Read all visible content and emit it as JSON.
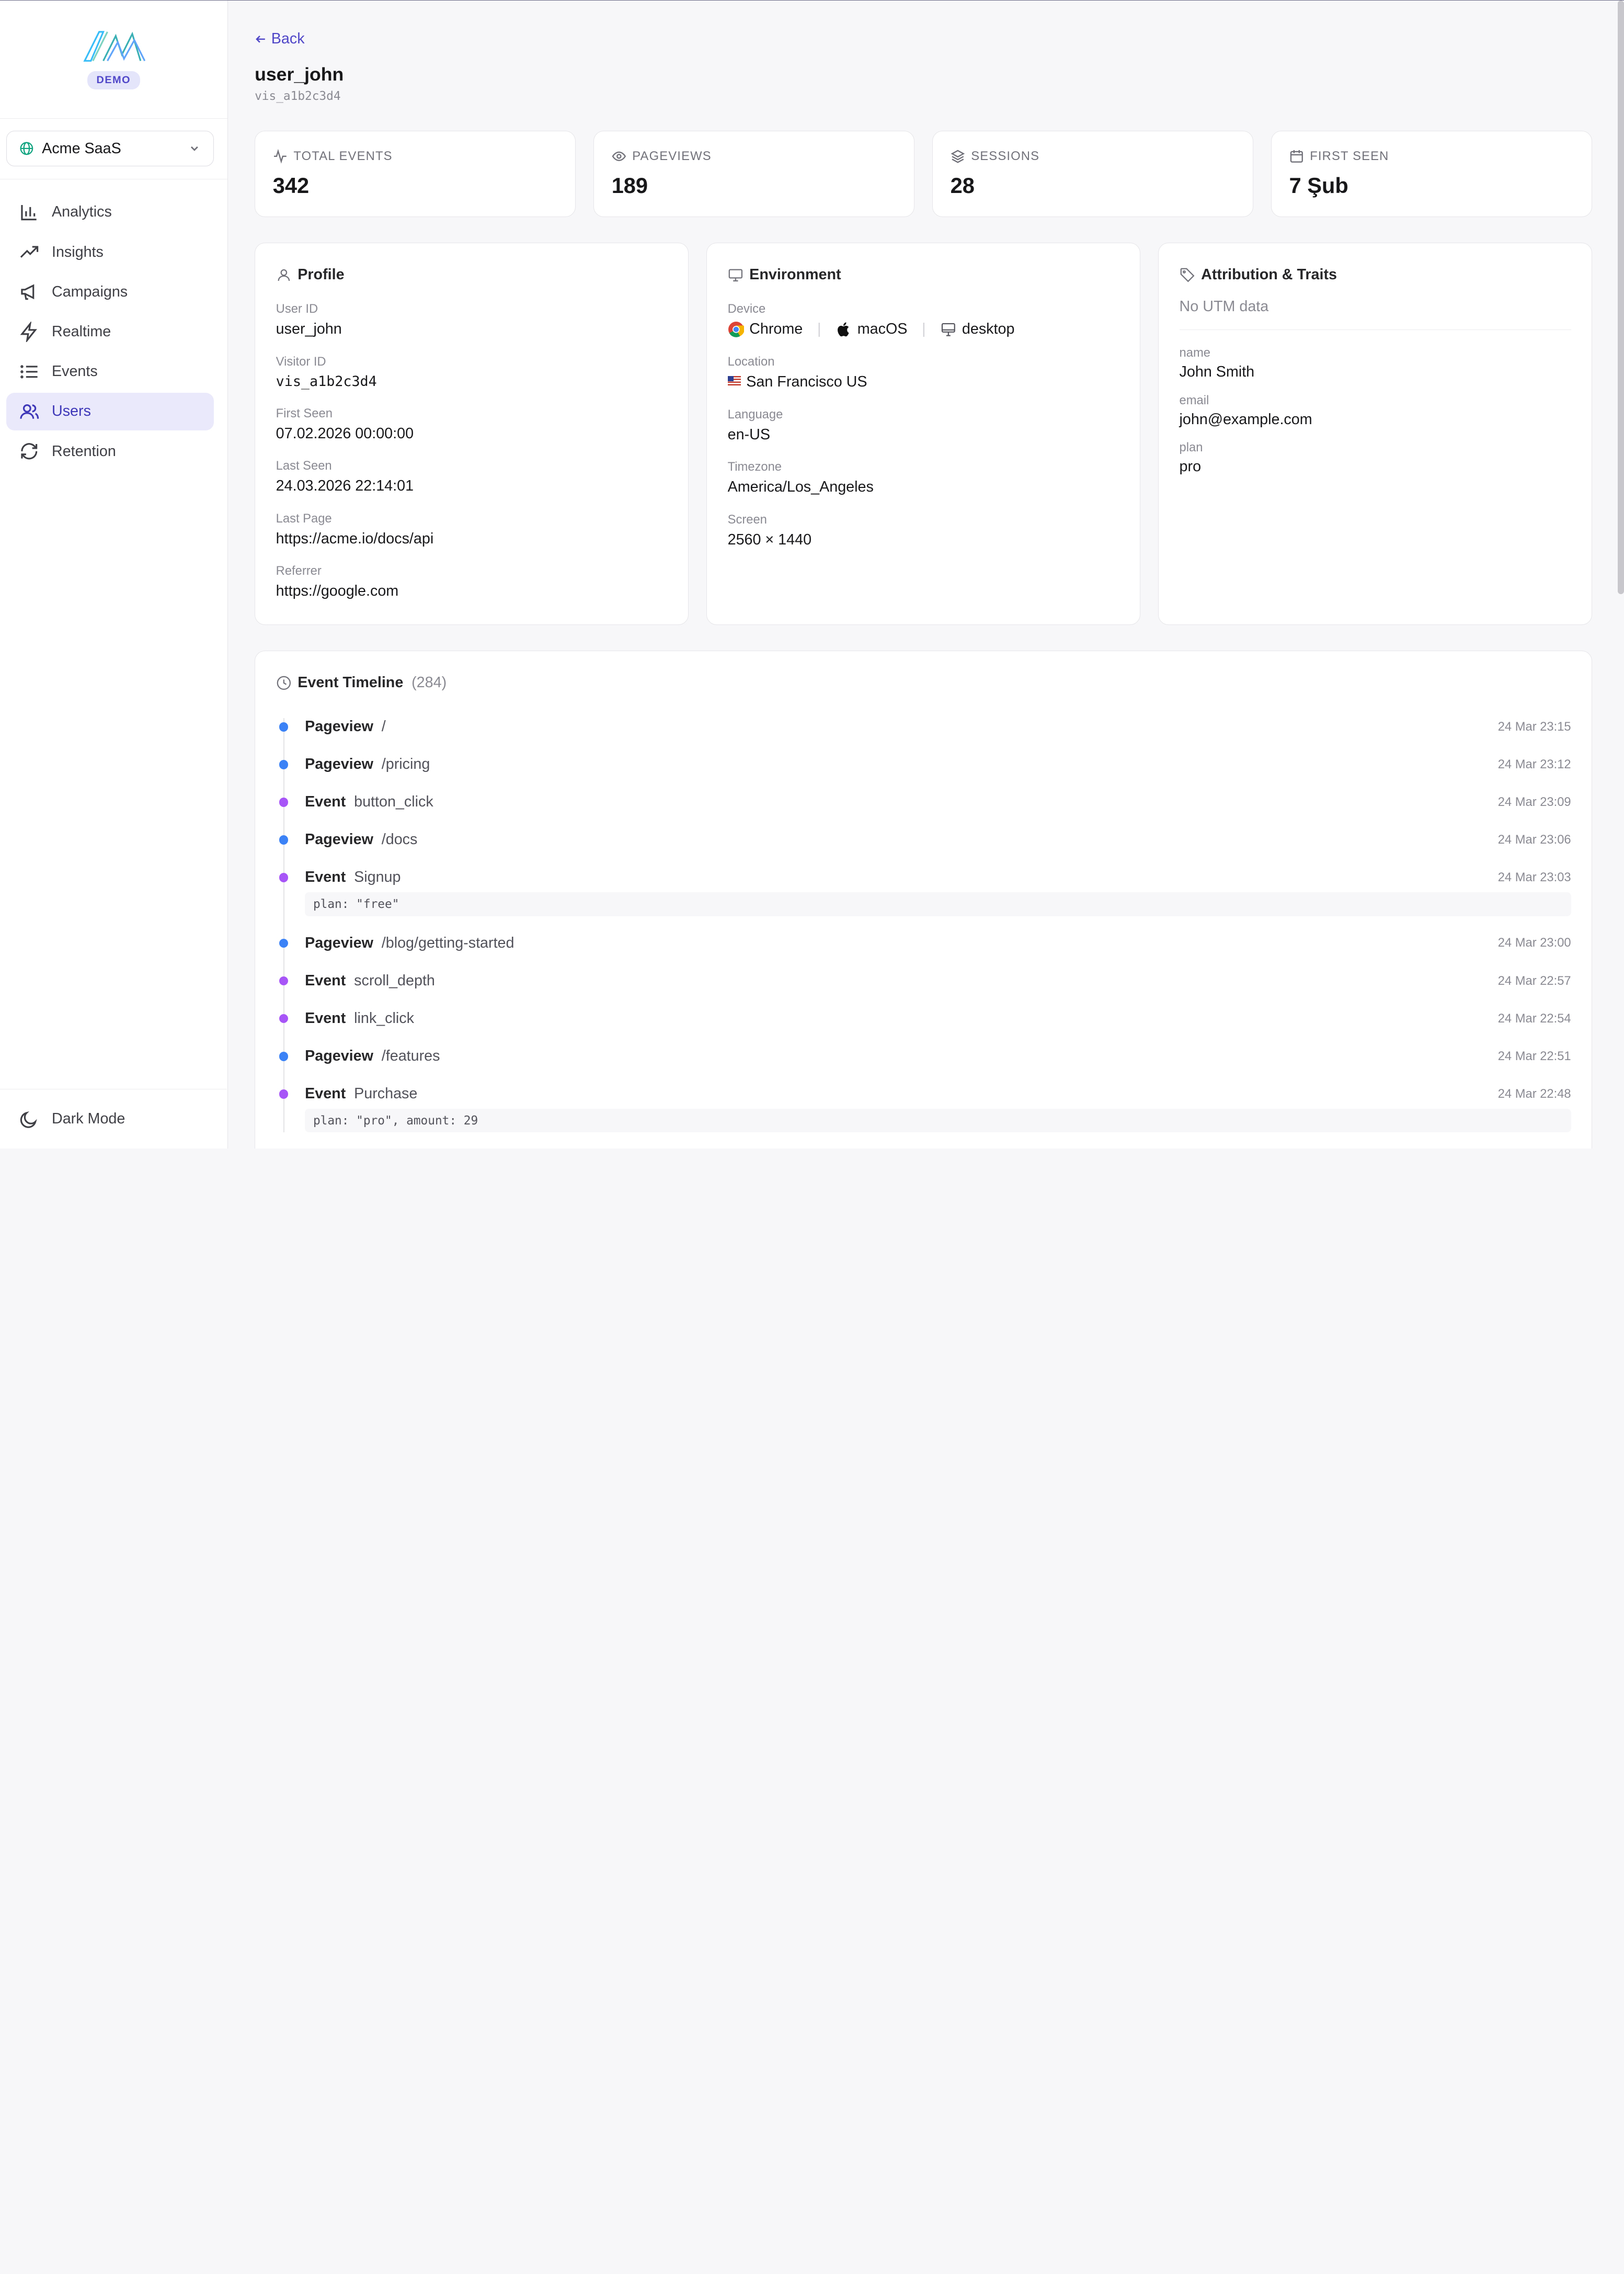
{
  "brand": {
    "badge": "DEMO"
  },
  "site_selector": {
    "value": "Acme SaaS"
  },
  "nav": {
    "items": [
      {
        "label": "Analytics",
        "icon": "bar-chart-icon"
      },
      {
        "label": "Insights",
        "icon": "trending-up-icon"
      },
      {
        "label": "Campaigns",
        "icon": "megaphone-icon"
      },
      {
        "label": "Realtime",
        "icon": "zap-icon"
      },
      {
        "label": "Events",
        "icon": "list-icon"
      },
      {
        "label": "Users",
        "icon": "users-icon",
        "active": true
      },
      {
        "label": "Retention",
        "icon": "refresh-icon"
      }
    ],
    "dark_mode": "Dark Mode"
  },
  "header": {
    "back": "Back",
    "title": "user_john",
    "subtitle": "vis_a1b2c3d4"
  },
  "stats": [
    {
      "label": "TOTAL EVENTS",
      "value": "342",
      "icon": "activity-icon"
    },
    {
      "label": "PAGEVIEWS",
      "value": "189",
      "icon": "eye-icon"
    },
    {
      "label": "SESSIONS",
      "value": "28",
      "icon": "layers-icon"
    },
    {
      "label": "FIRST SEEN",
      "value": "7 Şub",
      "icon": "calendar-icon"
    }
  ],
  "profile": {
    "title": "Profile",
    "fields": [
      {
        "label": "User ID",
        "value": "user_john"
      },
      {
        "label": "Visitor ID",
        "value": "vis_a1b2c3d4"
      },
      {
        "label": "First Seen",
        "value": "07.02.2026 00:00:00"
      },
      {
        "label": "Last Seen",
        "value": "24.03.2026 22:14:01"
      },
      {
        "label": "Last Page",
        "value": "https://acme.io/docs/api"
      },
      {
        "label": "Referrer",
        "value": "https://google.com"
      }
    ]
  },
  "environment": {
    "title": "Environment",
    "device_label": "Device",
    "browser": "Chrome",
    "os": "macOS",
    "device_type": "desktop",
    "location_label": "Location",
    "location": "San Francisco US",
    "language_label": "Language",
    "language": "en-US",
    "timezone_label": "Timezone",
    "timezone": "America/Los_Angeles",
    "screen_label": "Screen",
    "screen": "2560 × 1440"
  },
  "attribution": {
    "title": "Attribution & Traits",
    "no_utm": "No UTM data",
    "traits": [
      {
        "label": "name",
        "value": "John Smith"
      },
      {
        "label": "email",
        "value": "john@example.com"
      },
      {
        "label": "plan",
        "value": "pro"
      }
    ]
  },
  "timeline": {
    "title": "Event Timeline",
    "count": "(284)",
    "items": [
      {
        "kind": "pv",
        "type": "Pageview",
        "name": "/",
        "time": "24 Mar 23:15"
      },
      {
        "kind": "pv",
        "type": "Pageview",
        "name": "/pricing",
        "time": "24 Mar 23:12"
      },
      {
        "kind": "ev",
        "type": "Event",
        "name": "button_click",
        "time": "24 Mar 23:09"
      },
      {
        "kind": "pv",
        "type": "Pageview",
        "name": "/docs",
        "time": "24 Mar 23:06"
      },
      {
        "kind": "ev",
        "type": "Event",
        "name": "Signup",
        "time": "24 Mar 23:03",
        "props": "plan: \"free\""
      },
      {
        "kind": "pv",
        "type": "Pageview",
        "name": "/blog/getting-started",
        "time": "24 Mar 23:00"
      },
      {
        "kind": "ev",
        "type": "Event",
        "name": "scroll_depth",
        "time": "24 Mar 22:57"
      },
      {
        "kind": "ev",
        "type": "Event",
        "name": "link_click",
        "time": "24 Mar 22:54"
      },
      {
        "kind": "pv",
        "type": "Pageview",
        "name": "/features",
        "time": "24 Mar 22:51"
      },
      {
        "kind": "ev",
        "type": "Event",
        "name": "Purchase",
        "time": "24 Mar 22:48",
        "props": "plan: \"pro\", amount: 29"
      }
    ]
  },
  "colors": {
    "accent": "#4f46c8",
    "pageview_dot": "#3b82f6",
    "event_dot": "#a855f7"
  }
}
